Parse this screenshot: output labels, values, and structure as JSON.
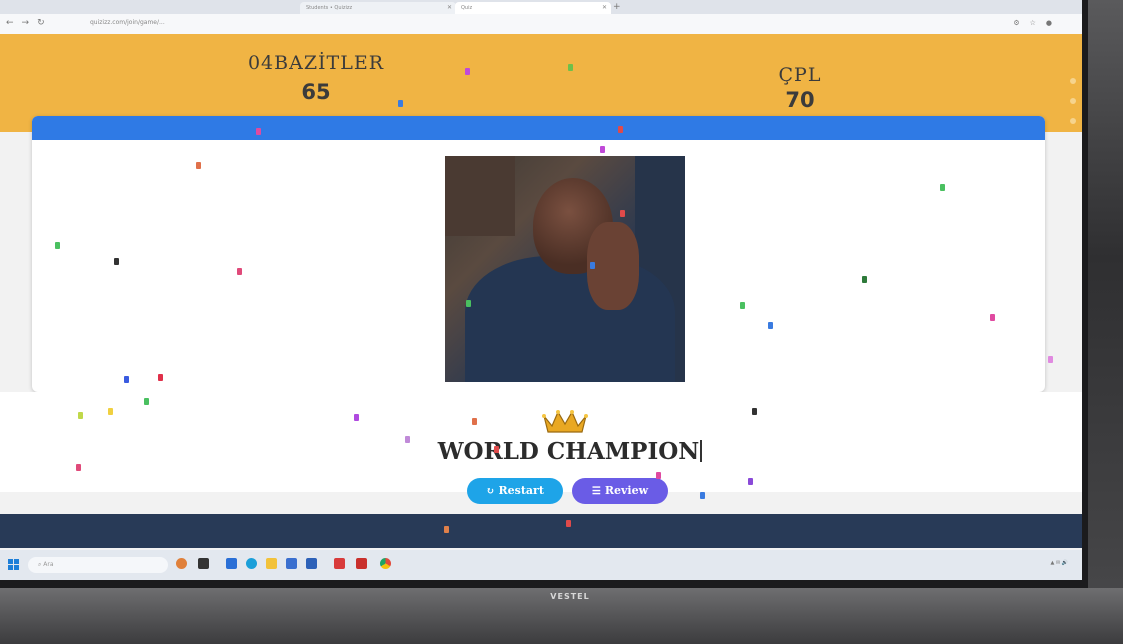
{
  "browser": {
    "tabs": [
      {
        "label": "Students • Quizizz"
      },
      {
        "label": "Quiz"
      }
    ],
    "new_tab_label": "+",
    "url": "quizizz.com/join/game/..."
  },
  "scoreboard": {
    "team1": {
      "name": "04BAZİTLER",
      "score": "65"
    },
    "team2": {
      "name": "ÇPL",
      "score": "70"
    }
  },
  "result": {
    "title": "WORLD CHAMPION",
    "restart_label": "Restart",
    "review_label": "Review"
  },
  "taskbar": {
    "search_placeholder": "Ara"
  },
  "monitor": {
    "brand": "VESTEL"
  },
  "colors": {
    "score_bar": "#f0b444",
    "card_header": "#2f7ae5",
    "restart_button": "#1ea4e8",
    "review_button": "#6a5ce6",
    "dark_band": "#283a57"
  },
  "icons": {
    "restart": "refresh-icon",
    "review": "review-icon",
    "crown": "crown-icon"
  }
}
